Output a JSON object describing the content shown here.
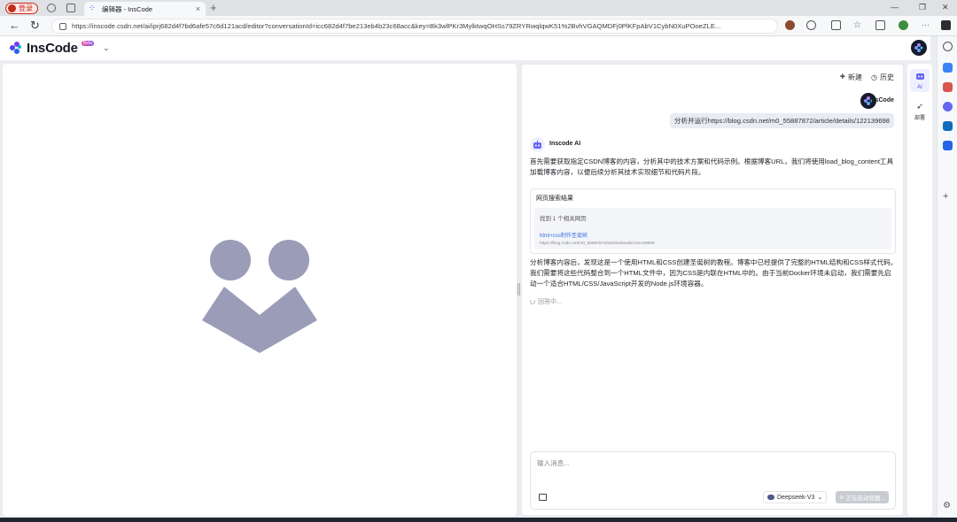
{
  "browser": {
    "profile_label": "登录",
    "tab_title": "编辑器 - InsCode",
    "tab_favicon": "InsCode mark",
    "url": "https://inscode.csdn.net/ai/iprj682d4f7bd6afe57c6d121acd/editor?conversationId=icc682d4f7be213eb4b23c68acc&key=Bk3wlPKr3MylktwqOHSs79ZRYRwqlqwK51%2BvhVGAQMDFj0PlKFpAbV1CybN0XuPOoeZLE...",
    "new_tab": "+",
    "close_tab": "×"
  },
  "header": {
    "logo_text": "InsCode",
    "beta_badge": "Beta"
  },
  "chat": {
    "new_label": "新建",
    "history_label": "历史",
    "user_name": "InsCode",
    "user_message": "分析并运行https://blog.csdn.net/m0_55887872/article/details/122139698",
    "ai_name": "Inscode AI",
    "ai_message_1": "首先需要获取指定CSDN博客的内容，分析其中的技术方案和代码示例。根据博客URL，我们将使用load_blog_content工具加载博客内容，以便后续分析其技术实现细节和代码片段。",
    "search_card": {
      "title": "网页搜索结果",
      "found": "找到 1 个相关网页",
      "result_title": "html+css制作圣诞树",
      "result_url": "https://blog.csdn.net/m0_55887872/article/details/122139698"
    },
    "ai_message_2": "分析博客内容后，发现这是一个使用HTML和CSS创建圣诞树的教程。博客中已经提供了完整的HTML结构和CSS样式代码。我们需要将这些代码整合到一个HTML文件中，因为CSS是内联在HTML中的。由于当前Docker环境未启动，我们需要先启动一个适合HTML/CSS/JavaScript开发的Node.js环境容器。",
    "loading_text": "回答中...",
    "input_placeholder": "输入消息...",
    "model_label": "Deepseek-V3",
    "send_label": "正在启动容器..."
  },
  "right_sidebar": {
    "ai_label": "AI",
    "deploy_label": "部署"
  },
  "colors": {
    "accent": "#4f46e5",
    "placeholder_graphic": "#9a9cb8",
    "link": "#2f6fe4"
  }
}
